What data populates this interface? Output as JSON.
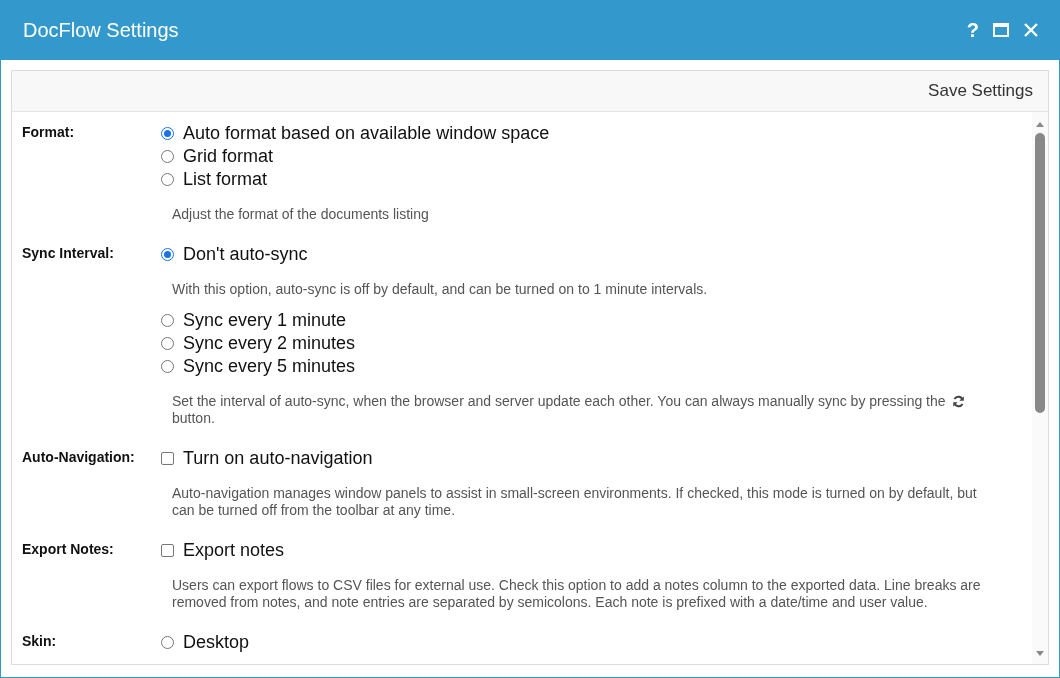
{
  "window": {
    "title": "DocFlow Settings",
    "controls": [
      "?"
    ]
  },
  "toolbar": {
    "save": "Save Settings"
  },
  "sections": [
    {
      "label": "Format:",
      "items": [
        {
          "kind": "radio",
          "text": "Auto format based on available window space",
          "selected": true
        },
        {
          "kind": "radio",
          "text": "Grid format",
          "selected": false
        },
        {
          "kind": "radio",
          "text": "List format",
          "selected": false
        },
        {
          "kind": "note",
          "text": "Adjust the format of the documents listing"
        }
      ]
    },
    {
      "label": "Sync Interval:",
      "items": [
        {
          "kind": "radio",
          "text": "Don't auto-sync",
          "selected": true
        },
        {
          "kind": "note",
          "text": "With this option, auto-sync is off by default, and can be turned on to 1 minute intervals."
        },
        {
          "kind": "radio",
          "text": "Sync every 1 minute",
          "selected": false
        },
        {
          "kind": "radio",
          "text": "Sync every 2 minutes",
          "selected": false
        },
        {
          "kind": "radio",
          "text": "Sync every 5 minutes",
          "selected": false
        },
        {
          "kind": "note",
          "text": "Set the interval of auto-sync, when the browser and server update each other. You can always manually sync by pressing the",
          "text_after": "button."
        }
      ]
    },
    {
      "label": "Auto-Navigation:",
      "items": [
        {
          "kind": "checkbox",
          "text": "Turn on auto-navigation",
          "checked": false
        },
        {
          "kind": "note",
          "text": "Auto-navigation manages window panels to assist in small-screen environments. If checked, this mode is turned on by default, but can be turned off from the toolbar at any time."
        }
      ]
    },
    {
      "label": "Export Notes:",
      "items": [
        {
          "kind": "checkbox",
          "text": "Export notes",
          "checked": false
        },
        {
          "kind": "note",
          "text": "Users can export flows to CSV files for external use. Check this option to add a notes column to the exported data. Line breaks are removed from notes, and note entries are separated by semicolons. Each note is prefixed with a date/time and user value."
        }
      ]
    },
    {
      "label": "Skin:",
      "items": [
        {
          "kind": "radio",
          "text": "Desktop",
          "selected": false
        }
      ]
    }
  ]
}
